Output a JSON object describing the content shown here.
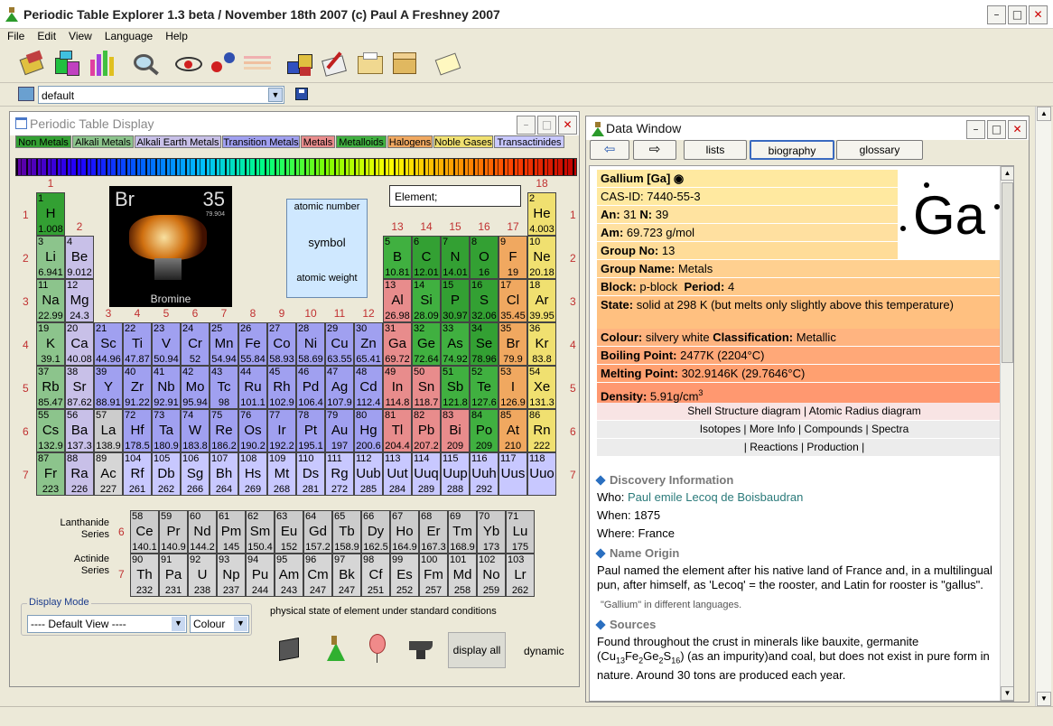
{
  "window": {
    "title": "Periodic Table Explorer 1.3 beta / November 18th 2007 (c) Paul A Freshney 2007"
  },
  "menu": [
    "File",
    "Edit",
    "View",
    "Language",
    "Help"
  ],
  "selector": {
    "value": "default"
  },
  "ptwin": {
    "title": "Periodic Table Display"
  },
  "categories": [
    {
      "label": "Non Metals",
      "color": "#33a033",
      "fg": "#000"
    },
    {
      "label": "Alkali Metals",
      "color": "#8cc48c",
      "fg": "#000"
    },
    {
      "label": "Alkali Earth Metals",
      "color": "#c8c0e8",
      "fg": "#000"
    },
    {
      "label": "Transition Metals",
      "color": "#a0a0f0",
      "fg": "#000"
    },
    {
      "label": "Metals",
      "color": "#e88c8c",
      "fg": "#000"
    },
    {
      "label": "Metalloids",
      "color": "#40b040",
      "fg": "#000"
    },
    {
      "label": "Halogens",
      "color": "#f0a860",
      "fg": "#000"
    },
    {
      "label": "Noble Gases",
      "color": "#f0e070",
      "fg": "#000"
    },
    {
      "label": "Transactinides",
      "color": "#c8c8ff",
      "fg": "#000"
    }
  ],
  "sample": {
    "symbol": "Br",
    "number": "35",
    "weight": "79.904",
    "name": "Bromine"
  },
  "legend": {
    "top": "atomic number",
    "mid": "symbol",
    "bottom": "atomic weight"
  },
  "element_box": {
    "label": "Element;"
  },
  "groups": [
    "1",
    "2",
    "3",
    "4",
    "5",
    "6",
    "7",
    "8",
    "9",
    "10",
    "11",
    "12",
    "13",
    "14",
    "15",
    "16",
    "17",
    "18"
  ],
  "periods": [
    "1",
    "2",
    "3",
    "4",
    "5",
    "6",
    "7"
  ],
  "colors": {
    "nm": "#33a033",
    "ak": "#8cc48c",
    "ae": "#c8c0e8",
    "tm": "#a0a0f0",
    "mt": "#e88c8c",
    "ml": "#40b040",
    "hl": "#f0a860",
    "ng": "#f0e070",
    "tr": "#c8c8ff",
    "lan": "#cccccc",
    "act": "#d6d6d6",
    "h": "#33a033"
  },
  "elements": [
    [
      "1",
      "H",
      "1.008",
      1,
      1,
      "h"
    ],
    [
      "2",
      "He",
      "4.003",
      18,
      1,
      "ng"
    ],
    [
      "3",
      "Li",
      "6.941",
      1,
      2,
      "ak"
    ],
    [
      "4",
      "Be",
      "9.012",
      2,
      2,
      "ae"
    ],
    [
      "5",
      "B",
      "10.81",
      13,
      2,
      "ml"
    ],
    [
      "6",
      "C",
      "12.01",
      14,
      2,
      "nm"
    ],
    [
      "7",
      "N",
      "14.01",
      15,
      2,
      "nm"
    ],
    [
      "8",
      "O",
      "16",
      16,
      2,
      "nm"
    ],
    [
      "9",
      "F",
      "19",
      17,
      2,
      "hl"
    ],
    [
      "10",
      "Ne",
      "20.18",
      18,
      2,
      "ng"
    ],
    [
      "11",
      "Na",
      "22.99",
      1,
      3,
      "ak"
    ],
    [
      "12",
      "Mg",
      "24.3",
      2,
      3,
      "ae"
    ],
    [
      "13",
      "Al",
      "26.98",
      13,
      3,
      "mt"
    ],
    [
      "14",
      "Si",
      "28.09",
      14,
      3,
      "ml"
    ],
    [
      "15",
      "P",
      "30.97",
      15,
      3,
      "nm"
    ],
    [
      "16",
      "S",
      "32.06",
      16,
      3,
      "nm"
    ],
    [
      "17",
      "Cl",
      "35.45",
      17,
      3,
      "hl"
    ],
    [
      "18",
      "Ar",
      "39.95",
      18,
      3,
      "ng"
    ],
    [
      "19",
      "K",
      "39.1",
      1,
      4,
      "ak"
    ],
    [
      "20",
      "Ca",
      "40.08",
      2,
      4,
      "ae"
    ],
    [
      "21",
      "Sc",
      "44.96",
      3,
      4,
      "tm"
    ],
    [
      "22",
      "Ti",
      "47.87",
      4,
      4,
      "tm"
    ],
    [
      "23",
      "V",
      "50.94",
      5,
      4,
      "tm"
    ],
    [
      "24",
      "Cr",
      "52",
      6,
      4,
      "tm"
    ],
    [
      "25",
      "Mn",
      "54.94",
      7,
      4,
      "tm"
    ],
    [
      "26",
      "Fe",
      "55.84",
      8,
      4,
      "tm"
    ],
    [
      "27",
      "Co",
      "58.93",
      9,
      4,
      "tm"
    ],
    [
      "28",
      "Ni",
      "58.69",
      10,
      4,
      "tm"
    ],
    [
      "29",
      "Cu",
      "63.55",
      11,
      4,
      "tm"
    ],
    [
      "30",
      "Zn",
      "65.41",
      12,
      4,
      "tm"
    ],
    [
      "31",
      "Ga",
      "69.72",
      13,
      4,
      "mt"
    ],
    [
      "32",
      "Ge",
      "72.64",
      14,
      4,
      "ml"
    ],
    [
      "33",
      "As",
      "74.92",
      15,
      4,
      "ml"
    ],
    [
      "34",
      "Se",
      "78.96",
      16,
      4,
      "nm"
    ],
    [
      "35",
      "Br",
      "79.9",
      17,
      4,
      "hl"
    ],
    [
      "36",
      "Kr",
      "83.8",
      18,
      4,
      "ng"
    ],
    [
      "37",
      "Rb",
      "85.47",
      1,
      5,
      "ak"
    ],
    [
      "38",
      "Sr",
      "87.62",
      2,
      5,
      "ae"
    ],
    [
      "39",
      "Y",
      "88.91",
      3,
      5,
      "tm"
    ],
    [
      "40",
      "Zr",
      "91.22",
      4,
      5,
      "tm"
    ],
    [
      "41",
      "Nb",
      "92.91",
      5,
      5,
      "tm"
    ],
    [
      "42",
      "Mo",
      "95.94",
      6,
      5,
      "tm"
    ],
    [
      "43",
      "Tc",
      "98",
      7,
      5,
      "tm"
    ],
    [
      "44",
      "Ru",
      "101.1",
      8,
      5,
      "tm"
    ],
    [
      "45",
      "Rh",
      "102.9",
      9,
      5,
      "tm"
    ],
    [
      "46",
      "Pd",
      "106.4",
      10,
      5,
      "tm"
    ],
    [
      "47",
      "Ag",
      "107.9",
      11,
      5,
      "tm"
    ],
    [
      "48",
      "Cd",
      "112.4",
      12,
      5,
      "tm"
    ],
    [
      "49",
      "In",
      "114.8",
      13,
      5,
      "mt"
    ],
    [
      "50",
      "Sn",
      "118.7",
      14,
      5,
      "mt"
    ],
    [
      "51",
      "Sb",
      "121.8",
      15,
      5,
      "ml"
    ],
    [
      "52",
      "Te",
      "127.6",
      16,
      5,
      "ml"
    ],
    [
      "53",
      "I",
      "126.9",
      17,
      5,
      "hl"
    ],
    [
      "54",
      "Xe",
      "131.3",
      18,
      5,
      "ng"
    ],
    [
      "55",
      "Cs",
      "132.9",
      1,
      6,
      "ak"
    ],
    [
      "56",
      "Ba",
      "137.3",
      2,
      6,
      "ae"
    ],
    [
      "57",
      "La",
      "138.9",
      3,
      6,
      "lan"
    ],
    [
      "72",
      "Hf",
      "178.5",
      4,
      6,
      "tm"
    ],
    [
      "73",
      "Ta",
      "180.9",
      5,
      6,
      "tm"
    ],
    [
      "74",
      "W",
      "183.8",
      6,
      6,
      "tm"
    ],
    [
      "75",
      "Re",
      "186.2",
      7,
      6,
      "tm"
    ],
    [
      "76",
      "Os",
      "190.2",
      8,
      6,
      "tm"
    ],
    [
      "77",
      "Ir",
      "192.2",
      9,
      6,
      "tm"
    ],
    [
      "78",
      "Pt",
      "195.1",
      10,
      6,
      "tm"
    ],
    [
      "79",
      "Au",
      "197",
      11,
      6,
      "tm"
    ],
    [
      "80",
      "Hg",
      "200.6",
      12,
      6,
      "tm"
    ],
    [
      "81",
      "Tl",
      "204.4",
      13,
      6,
      "mt"
    ],
    [
      "82",
      "Pb",
      "207.2",
      14,
      6,
      "mt"
    ],
    [
      "83",
      "Bi",
      "209",
      15,
      6,
      "mt"
    ],
    [
      "84",
      "Po",
      "209",
      16,
      6,
      "ml"
    ],
    [
      "85",
      "At",
      "210",
      17,
      6,
      "hl"
    ],
    [
      "86",
      "Rn",
      "222",
      18,
      6,
      "ng"
    ],
    [
      "87",
      "Fr",
      "223",
      1,
      7,
      "ak"
    ],
    [
      "88",
      "Ra",
      "226",
      2,
      7,
      "ae"
    ],
    [
      "89",
      "Ac",
      "227",
      3,
      7,
      "act"
    ],
    [
      "104",
      "Rf",
      "261",
      4,
      7,
      "tr"
    ],
    [
      "105",
      "Db",
      "262",
      5,
      7,
      "tr"
    ],
    [
      "106",
      "Sg",
      "266",
      6,
      7,
      "tr"
    ],
    [
      "107",
      "Bh",
      "264",
      7,
      7,
      "tr"
    ],
    [
      "108",
      "Hs",
      "269",
      8,
      7,
      "tr"
    ],
    [
      "109",
      "Mt",
      "268",
      9,
      7,
      "tr"
    ],
    [
      "110",
      "Ds",
      "281",
      10,
      7,
      "tr"
    ],
    [
      "111",
      "Rg",
      "272",
      11,
      7,
      "tr"
    ],
    [
      "112",
      "Uub",
      "285",
      12,
      7,
      "tr"
    ],
    [
      "113",
      "Uut",
      "284",
      13,
      7,
      "tr"
    ],
    [
      "114",
      "Uuq",
      "289",
      14,
      7,
      "tr"
    ],
    [
      "115",
      "Uup",
      "288",
      15,
      7,
      "tr"
    ],
    [
      "116",
      "Uuh",
      "292",
      16,
      7,
      "tr"
    ],
    [
      "117",
      "Uus",
      "",
      17,
      7,
      "tr"
    ],
    [
      "118",
      "Uuo",
      "",
      18,
      7,
      "tr"
    ]
  ],
  "lanthanides": [
    [
      "58",
      "Ce",
      "140.1"
    ],
    [
      "59",
      "Pr",
      "140.9"
    ],
    [
      "60",
      "Nd",
      "144.2"
    ],
    [
      "61",
      "Pm",
      "145"
    ],
    [
      "62",
      "Sm",
      "150.4"
    ],
    [
      "63",
      "Eu",
      "152"
    ],
    [
      "64",
      "Gd",
      "157.2"
    ],
    [
      "65",
      "Tb",
      "158.9"
    ],
    [
      "66",
      "Dy",
      "162.5"
    ],
    [
      "67",
      "Ho",
      "164.9"
    ],
    [
      "68",
      "Er",
      "167.3"
    ],
    [
      "69",
      "Tm",
      "168.9"
    ],
    [
      "70",
      "Yb",
      "173"
    ],
    [
      "71",
      "Lu",
      "175"
    ]
  ],
  "actinides": [
    [
      "90",
      "Th",
      "232"
    ],
    [
      "91",
      "Pa",
      "231"
    ],
    [
      "92",
      "U",
      "238"
    ],
    [
      "93",
      "Np",
      "237"
    ],
    [
      "94",
      "Pu",
      "244"
    ],
    [
      "95",
      "Am",
      "243"
    ],
    [
      "96",
      "Cm",
      "247"
    ],
    [
      "97",
      "Bk",
      "247"
    ],
    [
      "98",
      "Cf",
      "251"
    ],
    [
      "99",
      "Es",
      "252"
    ],
    [
      "100",
      "Fm",
      "257"
    ],
    [
      "101",
      "Md",
      "258"
    ],
    [
      "102",
      "No",
      "259"
    ],
    [
      "103",
      "Lr",
      "262"
    ]
  ],
  "series_labels": {
    "lan": "Lanthanide\nSeries",
    "lan_num": "6",
    "act": "Actinide\nSeries",
    "act_num": "7"
  },
  "display_mode": {
    "label": "Display Mode",
    "view": "---- Default View ----",
    "colour": "Colour",
    "state_caption": "physical state of element under standard conditions",
    "display_all": "display all",
    "dynamic": "dynamic"
  },
  "datawin": {
    "title": "Data Window",
    "tabs": [
      "lists",
      "biography",
      "glossary"
    ]
  },
  "data": {
    "name": "Gallium [Ga]",
    "cas": "CAS-ID: 7440-55-3",
    "an_label": "An:",
    "an": "31",
    "nn_label": "N:",
    "nn": "39",
    "am_label": "Am:",
    "am": "69.723 g/mol",
    "group_label": "Group No:",
    "group": "13",
    "big_symbol": "Ga",
    "groupname_label": "Group Name:",
    "groupname": "Metals",
    "block_label": "Block:",
    "block": "p-block",
    "period_label": "Period:",
    "period": "4",
    "state_label": "State:",
    "state": "solid at 298 K (but melts only slightly above this temperature)",
    "colour_label": "Colour:",
    "colour": "silvery white",
    "class_label": "Classification:",
    "class": "Metallic",
    "boil_label": "Boiling Point:",
    "boil": "2477K (2204°C)",
    "melt_label": "Melting Point:",
    "melt": "302.9146K (29.7646°C)",
    "dens_label": "Density:",
    "dens": "5.91g/cm",
    "dens_sup": "3",
    "links1": [
      "Shell Structure diagram",
      "|",
      "Atomic Radius diagram"
    ],
    "links2": [
      "Isotopes",
      "|",
      "More Info",
      "|",
      "Compounds",
      "|",
      "Spectra"
    ],
    "links3": [
      "|",
      "Reactions",
      "|",
      "Production",
      "|"
    ]
  },
  "bio": {
    "disc_title": "Discovery Information",
    "who_label": "Who:",
    "who": "Paul emile Lecoq de Boisbaudran",
    "when": "When: 1875",
    "where": "Where: France",
    "origin_title": "Name Origin",
    "origin": "Paul named the element after his native land of France and, in a multilingual pun, after himself, as 'Lecoq' = the rooster, and Latin for rooster is \"gallus\".",
    "langs": "\"Gallium\" in different languages.",
    "sources_title": "Sources",
    "sources_a": "Found throughout the crust in minerals like bauxite, germanite (Cu",
    "s1": "13",
    "sources_b": "Fe",
    "s2": "2",
    "sources_c": "Ge",
    "s3": "2",
    "sources_d": "S",
    "s4": "16",
    "sources_e": ") (as an impurity)and coal, but does not exist in pure form in nature. Around 30 tons are produced each year."
  }
}
